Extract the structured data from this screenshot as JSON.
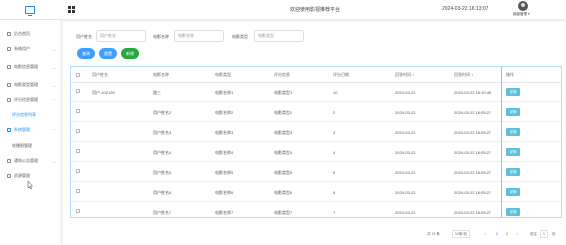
{
  "app": {
    "title": "欢迎使用影视推荐平台",
    "datetime": "2024-03-22 16:13:07",
    "username": "超级管理 ▾"
  },
  "sidebar": {
    "items": [
      {
        "label": "后台首页"
      },
      {
        "label": "系统用户"
      },
      {
        "label": "电影信息管理"
      },
      {
        "label": "电影类型管理"
      },
      {
        "label": "评分信息管理"
      },
      {
        "label": "评分信息列表"
      },
      {
        "label": "系统管理"
      },
      {
        "label": "轮播图管理"
      },
      {
        "label": "通知公告管理"
      },
      {
        "label": "资源管理"
      }
    ]
  },
  "search": {
    "username_label": "用户姓名",
    "username_placeholder": "用户姓名",
    "movie_label": "电影名称",
    "movie_placeholder": "电影名称",
    "type_label": "电影类型",
    "type_placeholder": "电影类型"
  },
  "toolbar": {
    "search": "查询",
    "reset": "重置",
    "add": "新增"
  },
  "table": {
    "headers": [
      "",
      "用户姓名",
      "电影名称",
      "电影类型",
      "评分信息",
      "评分日期",
      "回答时间 ↕",
      "操作"
    ],
    "detail_label": "详情",
    "rows": [
      {
        "username": "用户-102120",
        "name": "路三",
        "movie": "电影名称1",
        "type": "电影类型1",
        "score": "10",
        "date": "2024-03-22",
        "time": "2024-03-22 16:10:46"
      },
      {
        "username": "",
        "name": "用户姓名2",
        "movie": "电影名称2",
        "type": "电影类型2",
        "score": "2",
        "date": "2024-03-22",
        "time": "2024-03-22 16:05:27"
      },
      {
        "username": "",
        "name": "用户姓名3",
        "movie": "电影名称3",
        "type": "电影类型3",
        "score": "3",
        "date": "2024-03-22",
        "time": "2024-03-22 16:05:27"
      },
      {
        "username": "",
        "name": "用户姓名4",
        "movie": "电影名称4",
        "type": "电影类型4",
        "score": "4",
        "date": "2024-03-22",
        "time": "2024-03-22 16:05:27"
      },
      {
        "username": "",
        "name": "用户姓名5",
        "movie": "电影名称5",
        "type": "电影类型5",
        "score": "5",
        "date": "2024-03-22",
        "time": "2024-03-22 16:05:27"
      },
      {
        "username": "",
        "name": "用户姓名6",
        "movie": "电影名称6",
        "type": "电影类型6",
        "score": "6",
        "date": "2024-03-22",
        "time": "2024-03-22 16:05:27"
      },
      {
        "username": "",
        "name": "用户姓名7",
        "movie": "电影名称7",
        "type": "电影类型7",
        "score": "7",
        "date": "2024-03-22",
        "time": "2024-03-22 16:05:27"
      }
    ]
  },
  "pagination": {
    "total": "共 13 条",
    "page_size": "10条/页",
    "prev": "‹",
    "pages": [
      "1",
      "2"
    ],
    "current_page": "1",
    "next": "›",
    "goto_label": "前往",
    "goto_value": "1",
    "goto_suffix": "页"
  },
  "colors": {
    "accent": "#409eff",
    "add": "#28a745",
    "detail": "#5bc0de"
  }
}
